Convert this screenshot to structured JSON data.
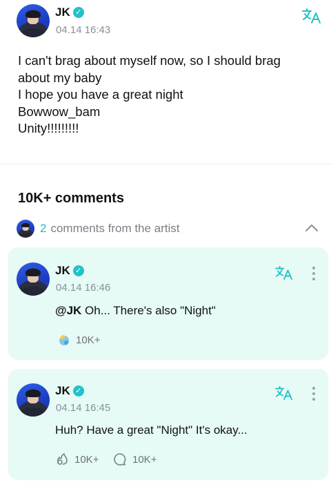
{
  "post": {
    "author": "JK",
    "timestamp": "04.14 16:43",
    "lines": [
      "I can't brag about myself now, so I should brag",
      "about my baby",
      "I hope you have a great night",
      "Bowwow_bam",
      "Unity!!!!!!!!!"
    ],
    "translate_icon": "translate-icon"
  },
  "comments_section": {
    "title": "10K+ comments",
    "artist_count": "2",
    "artist_label": "comments from the artist"
  },
  "comments": [
    {
      "author": "JK",
      "timestamp": "04.14 16:46",
      "mention": "@JK",
      "text": " Oh... There's also \"Night\"",
      "likes": "10K+"
    },
    {
      "author": "JK",
      "timestamp": "04.14 16:45",
      "text": "Huh? Have a great \"Night\" It's okay...",
      "likes": "10K+",
      "replies": "10K+"
    }
  ],
  "colors": {
    "accent": "#22c2c9",
    "card_bg": "#e6faf6",
    "muted_text": "#8a8f96"
  }
}
